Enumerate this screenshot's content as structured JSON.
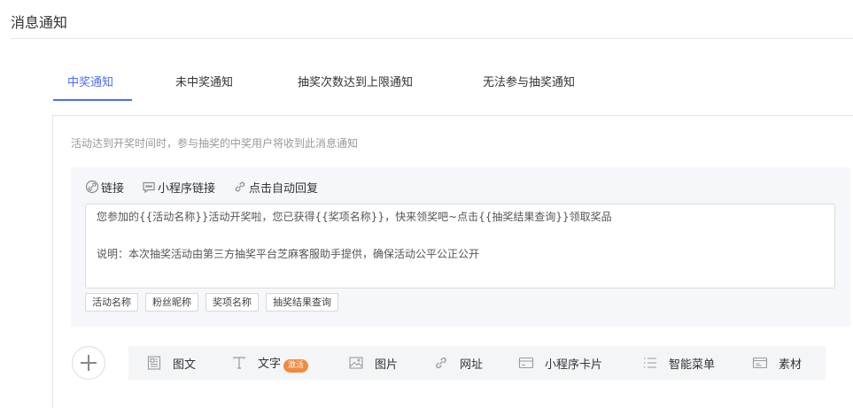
{
  "page": {
    "title": "消息通知"
  },
  "tabs": [
    {
      "label": "中奖通知",
      "active": true
    },
    {
      "label": "未中奖通知",
      "active": false
    },
    {
      "label": "抽奖次数达到上限通知",
      "active": false
    },
    {
      "label": "无法参与抽奖通知",
      "active": false
    }
  ],
  "panel": {
    "description": "活动达到开奖时间时，参与抽奖的中奖用户将收到此消息通知"
  },
  "editor": {
    "toolbar": [
      {
        "label": "链接",
        "icon": "link-circle-icon"
      },
      {
        "label": "小程序链接",
        "icon": "chat-bubble-icon"
      },
      {
        "label": "点击自动回复",
        "icon": "link-icon"
      }
    ],
    "content_line1": "您参加的{{活动名称}}活动开奖啦，您已获得{{奖项名称}}，快来领奖吧~点击{{抽奖结果查询}}领取奖品",
    "content_line2": "说明：本次抽奖活动由第三方抽奖平台芝麻客服助手提供，确保活动公平公正公开",
    "variables": [
      "活动名称",
      "粉丝昵称",
      "奖项名称",
      "抽奖结果查询"
    ]
  },
  "media_bar": {
    "items": [
      {
        "label": "图文",
        "icon": "article-icon"
      },
      {
        "label": "文字",
        "icon": "text-icon",
        "badge": "激活"
      },
      {
        "label": "图片",
        "icon": "image-icon"
      },
      {
        "label": "网址",
        "icon": "link-icon"
      },
      {
        "label": "小程序卡片",
        "icon": "card-icon"
      },
      {
        "label": "智能菜单",
        "icon": "menu-list-icon"
      },
      {
        "label": "素材",
        "icon": "material-icon"
      }
    ]
  },
  "colors": {
    "accent": "#4a6ef5",
    "badge": "#f08a3e",
    "muted_text": "#999999"
  }
}
